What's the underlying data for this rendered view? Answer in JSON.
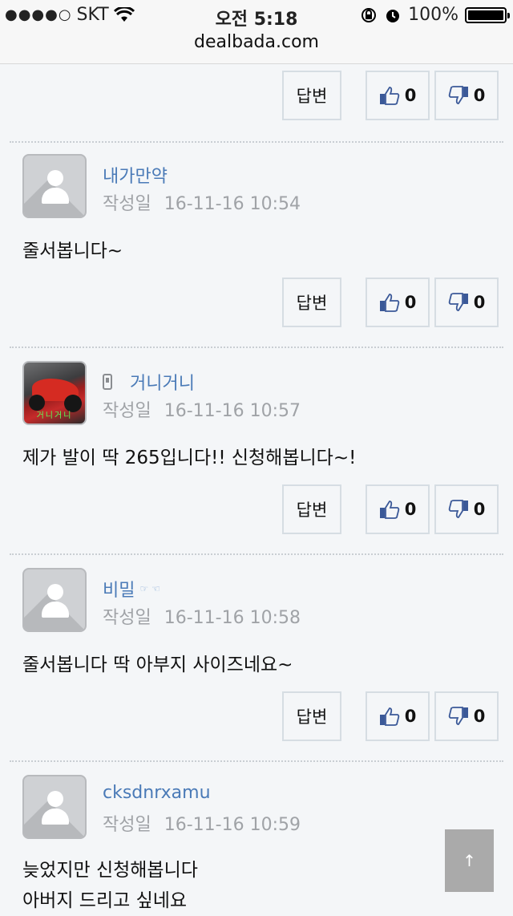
{
  "status_bar": {
    "signal": "●●●●○",
    "carrier": "SKT",
    "time": "오전 5:18",
    "battery": "100%",
    "url": "dealbada.com"
  },
  "buttons": {
    "reply": "답변",
    "like": "0",
    "dislike": "0"
  },
  "comments": [
    {
      "author": "내가만약",
      "date_label": "작성일",
      "date": "16-11-16 10:54",
      "text": "줄서봅니다~"
    },
    {
      "author": "거니거니",
      "date_label": "작성일",
      "date": "16-11-16 10:57",
      "text": "제가 발이 딱 265입니다!! 신청해봅니다~!",
      "avatar_text": "거니거니"
    },
    {
      "author": "비밀",
      "author_suffix": "☞ ☜",
      "date_label": "작성일",
      "date": "16-11-16 10:58",
      "text": "줄서봅니다 딱 아부지 사이즈네요~"
    },
    {
      "author": "cksdnrxamu",
      "date_label": "작성일",
      "date": "16-11-16 10:59",
      "text": "늦었지만 신청해봅니다",
      "text2": "아버지 드리고 싶네요"
    }
  ],
  "scroll_top": "↑",
  "colors": {
    "author": "#4a7ab7",
    "meta": "#a0a3a7",
    "like_icon": "#3b5998"
  }
}
